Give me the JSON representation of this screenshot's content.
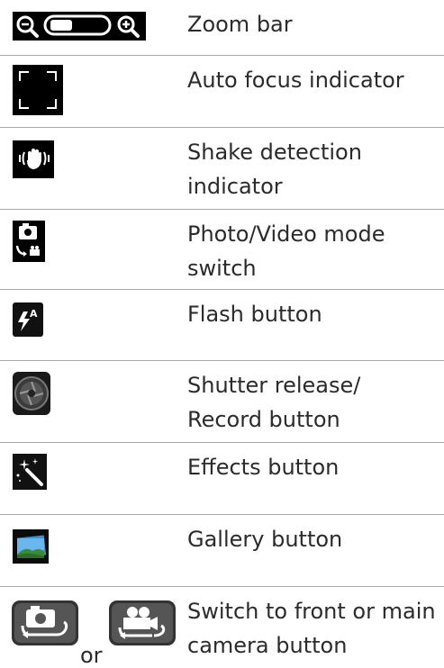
{
  "rows": [
    {
      "label": "Zoom bar",
      "icon": "zoom-bar-icon"
    },
    {
      "label": "Auto focus indicator",
      "icon": "autofocus-frame-icon"
    },
    {
      "label": "Shake detection indicator",
      "icon": "shake-hand-icon"
    },
    {
      "label": "Photo/Video mode switch",
      "icon": "camera-video-switch-icon"
    },
    {
      "label": "Flash button",
      "icon": "flash-auto-icon"
    },
    {
      "label": "Shutter release/ Record button",
      "icon": "shutter-aperture-icon"
    },
    {
      "label": "Effects button",
      "icon": "magic-wand-icon"
    },
    {
      "label": "Gallery button",
      "icon": "gallery-landscape-icon"
    },
    {
      "label": "Switch to front or main camera button",
      "icon": "camera-switch-icon",
      "or_text": "or"
    }
  ],
  "colors": {
    "text": "#2b2b2b",
    "divider": "#a8a8a8",
    "icon_bg": "#000000"
  }
}
